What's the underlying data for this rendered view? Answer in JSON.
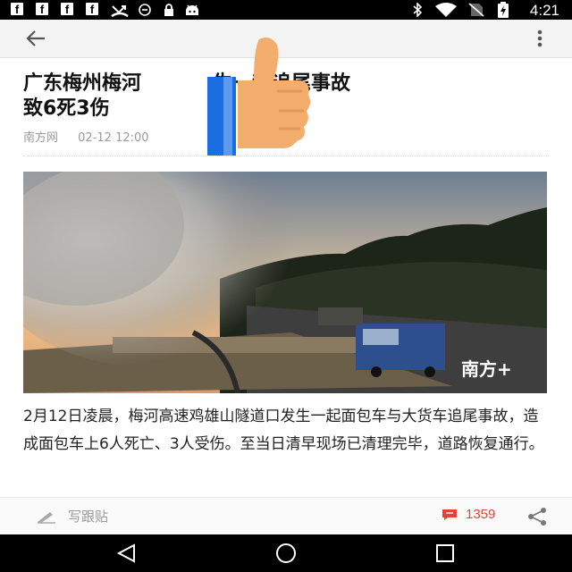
{
  "status_bar": {
    "notification_icons": [
      "facebook-icon",
      "facebook-icon",
      "facebook-icon",
      "facebook-icon",
      "missed-call-icon",
      "sync-icon",
      "lock-icon",
      "android-icon"
    ],
    "system_icons": [
      "bluetooth-icon",
      "wifi-icon",
      "no-sim-icon",
      "battery-charging-icon"
    ],
    "time": "4:21"
  },
  "toolbar": {
    "back_icon": "arrow-left-icon",
    "more_icon": "more-vertical-icon"
  },
  "article": {
    "title": "广东梅州梅河高速发生一起追尾事故致6死3伤",
    "title_line1_visible": "广东梅州梅河",
    "title_line1_tail": "生一起追尾事故",
    "title_line2": "致6死3伤",
    "source": "南方网",
    "datetime": "02-12 12:00",
    "image_watermark": "南方+",
    "body": "2月12日凌晨，梅河高速鸡雄山隧道口发生一起面包车与大货车追尾事故，造成面包车上6人死亡、3人受伤。至当日清早现场已清理完毕，道路恢复通行。"
  },
  "overlay": {
    "icon": "thumbs-up-icon",
    "colors": {
      "thumb": "#f3ad6d",
      "cuff": "#1a6fe0"
    }
  },
  "bottom_bar": {
    "reply_placeholder": "写跟贴",
    "comment_count": "1359",
    "accent_color": "#e0433b"
  },
  "nav_bar": {
    "buttons": [
      "back-triangle-icon",
      "home-circle-icon",
      "recents-square-icon"
    ]
  }
}
